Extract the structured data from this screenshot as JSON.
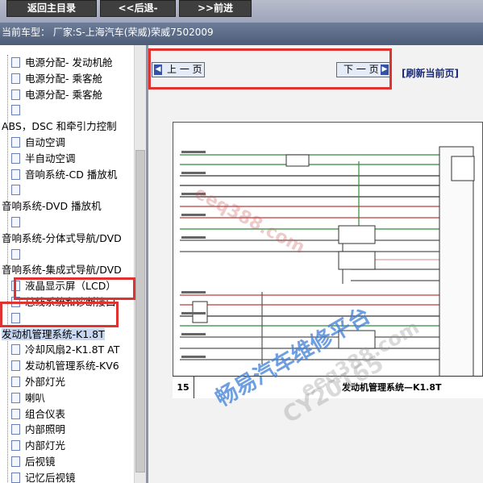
{
  "toolbar": {
    "home_label": "返回主目录",
    "back_label": "<<后退-",
    "forward_label": ">>前进"
  },
  "vehicle_info": "当前车型： 厂家:S-上海汽车(荣威)荣威7502009",
  "tree": {
    "items": [
      {
        "label": "电源分配- 发动机舱",
        "indent": true,
        "icon": true
      },
      {
        "label": "电源分配- 乘客舱",
        "indent": true,
        "icon": true
      },
      {
        "label": "电源分配- 乘客舱",
        "indent": true,
        "icon": true
      },
      {
        "label": "",
        "indent": true,
        "icon": true
      },
      {
        "label": "ABS，DSC 和牵引力控制",
        "indent": false,
        "icon": false
      },
      {
        "label": "自动空调",
        "indent": true,
        "icon": true
      },
      {
        "label": "半自动空调",
        "indent": true,
        "icon": true
      },
      {
        "label": "音响系统-CD 播放机",
        "indent": true,
        "icon": true
      },
      {
        "label": "",
        "indent": true,
        "icon": true
      },
      {
        "label": "音响系统-DVD 播放机",
        "indent": false,
        "icon": false
      },
      {
        "label": "",
        "indent": true,
        "icon": true
      },
      {
        "label": "音响系统-分体式导航/DVD",
        "indent": false,
        "icon": false
      },
      {
        "label": "",
        "indent": true,
        "icon": true
      },
      {
        "label": "音响系统-集成式导航/DVD",
        "indent": false,
        "icon": false
      },
      {
        "label": "液晶显示屏（LCD）",
        "indent": true,
        "icon": true
      },
      {
        "label": "总线系统和诊断接口",
        "indent": true,
        "icon": true
      },
      {
        "label": "",
        "indent": true,
        "icon": true
      },
      {
        "label": "发动机管理系统-K1.8T",
        "indent": false,
        "icon": false,
        "selected": true
      },
      {
        "label": "冷却风扇2-K1.8T AT",
        "indent": true,
        "icon": true
      },
      {
        "label": "发动机管理系统-KV6",
        "indent": true,
        "icon": true
      },
      {
        "label": "外部灯光",
        "indent": true,
        "icon": true
      },
      {
        "label": "喇叭",
        "indent": true,
        "icon": true
      },
      {
        "label": "组合仪表",
        "indent": true,
        "icon": true
      },
      {
        "label": "内部照明",
        "indent": true,
        "icon": true
      },
      {
        "label": "内部灯光",
        "indent": true,
        "icon": true
      },
      {
        "label": "后视镜",
        "indent": true,
        "icon": true
      },
      {
        "label": "记忆后视镜",
        "indent": true,
        "icon": true
      },
      {
        "label": "",
        "indent": true,
        "icon": true
      }
    ]
  },
  "pager": {
    "prev_label": "上 一 页",
    "next_label": "下 一 页",
    "refresh_label": "[刷新当前页]"
  },
  "diagram": {
    "page_number": "15",
    "title": "发动机管理系统—K1.8T"
  },
  "watermarks": {
    "site": "eeq388.com",
    "platform": "畅易汽车维修平台",
    "site2": "eeq388.com",
    "code": "CY20165"
  },
  "colors": {
    "highlight_box": "#e0322f",
    "selection": "#c9d8f2",
    "watermark_blue": "#3f7fd6"
  }
}
